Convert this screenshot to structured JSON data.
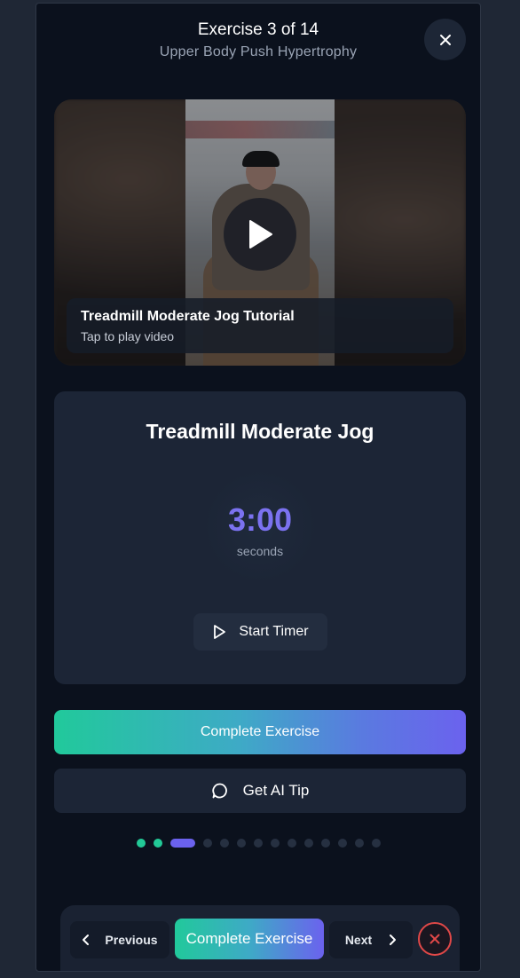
{
  "header": {
    "title": "Exercise 3 of 14",
    "subtitle": "Upper Body Push Hypertrophy",
    "close_icon": "close-icon"
  },
  "video": {
    "title": "Treadmill Moderate Jog Tutorial",
    "subtitle": "Tap to play video",
    "play_icon": "play-icon"
  },
  "exercise": {
    "name": "Treadmill Moderate Jog",
    "timer_value": "3:00",
    "timer_unit": "seconds",
    "start_timer_label": "Start Timer"
  },
  "actions": {
    "complete_label": "Complete Exercise",
    "ai_tip_label": "Get AI Tip",
    "ai_tip_icon": "chat-bubble-icon"
  },
  "progress": {
    "total": 14,
    "current": 3,
    "completed": 2
  },
  "nav": {
    "previous_label": "Previous",
    "complete_label": "Complete Exercise",
    "next_label": "Next",
    "stop_icon": "stop-icon"
  },
  "colors": {
    "accent_green": "#21c99b",
    "accent_purple": "#6b62ee",
    "danger": "#e04848"
  }
}
